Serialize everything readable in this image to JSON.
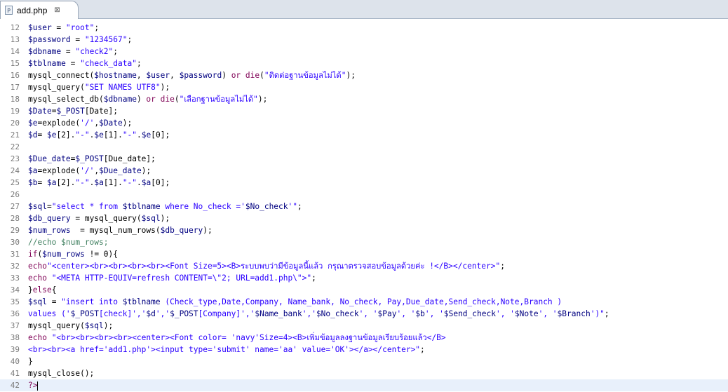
{
  "tab": {
    "label": "add.php",
    "close_symbol": "⊠"
  },
  "lines": [
    {
      "n": 12,
      "segs": [
        [
          "sv",
          "$user"
        ],
        [
          "op",
          " = "
        ],
        [
          "str",
          "\"root\""
        ],
        [
          "op",
          ";"
        ]
      ]
    },
    {
      "n": 13,
      "segs": [
        [
          "sv",
          "$password"
        ],
        [
          "op",
          " = "
        ],
        [
          "str",
          "\"1234567\""
        ],
        [
          "op",
          ";"
        ]
      ]
    },
    {
      "n": 14,
      "segs": [
        [
          "sv",
          "$dbname"
        ],
        [
          "op",
          " = "
        ],
        [
          "str",
          "\"check2\""
        ],
        [
          "op",
          ";"
        ]
      ]
    },
    {
      "n": 15,
      "segs": [
        [
          "sv",
          "$tblname"
        ],
        [
          "op",
          " = "
        ],
        [
          "str",
          "\"check_data\""
        ],
        [
          "op",
          ";"
        ]
      ]
    },
    {
      "n": 16,
      "segs": [
        [
          "op",
          "mysql_connect("
        ],
        [
          "sv",
          "$hostname"
        ],
        [
          "op",
          ", "
        ],
        [
          "sv",
          "$user"
        ],
        [
          "op",
          ", "
        ],
        [
          "sv",
          "$password"
        ],
        [
          "op",
          ") "
        ],
        [
          "kw",
          "or die"
        ],
        [
          "op",
          "("
        ],
        [
          "str",
          "\"ติดต่อฐานข้อมูลไม่ได้\""
        ],
        [
          "op",
          ");"
        ]
      ]
    },
    {
      "n": 17,
      "segs": [
        [
          "op",
          "mysql_query("
        ],
        [
          "str",
          "\"SET NAMES UTF8\""
        ],
        [
          "op",
          ");"
        ]
      ]
    },
    {
      "n": 18,
      "segs": [
        [
          "op",
          "mysql_select_db("
        ],
        [
          "sv",
          "$dbname"
        ],
        [
          "op",
          ") "
        ],
        [
          "kw",
          "or die"
        ],
        [
          "op",
          "("
        ],
        [
          "str",
          "\"เลือกฐานข้อมูลไม่ได้\""
        ],
        [
          "op",
          ");"
        ]
      ]
    },
    {
      "n": 19,
      "segs": [
        [
          "sv",
          "$Date"
        ],
        [
          "op",
          "="
        ],
        [
          "sv",
          "$_POST"
        ],
        [
          "op",
          "[Date];"
        ]
      ]
    },
    {
      "n": 20,
      "segs": [
        [
          "sv",
          "$e"
        ],
        [
          "op",
          "=explode("
        ],
        [
          "str",
          "'/'"
        ],
        [
          "op",
          ","
        ],
        [
          "sv",
          "$Date"
        ],
        [
          "op",
          ");"
        ]
      ]
    },
    {
      "n": 21,
      "segs": [
        [
          "sv",
          "$d"
        ],
        [
          "op",
          "= "
        ],
        [
          "sv",
          "$e"
        ],
        [
          "op",
          "[2]."
        ],
        [
          "str",
          "\"-\""
        ],
        [
          "op",
          "."
        ],
        [
          "sv",
          "$e"
        ],
        [
          "op",
          "[1]."
        ],
        [
          "str",
          "\"-\""
        ],
        [
          "op",
          "."
        ],
        [
          "sv",
          "$e"
        ],
        [
          "op",
          "[0];"
        ]
      ]
    },
    {
      "n": 22,
      "segs": []
    },
    {
      "n": 23,
      "segs": [
        [
          "sv",
          "$Due_date"
        ],
        [
          "op",
          "="
        ],
        [
          "sv",
          "$_POST"
        ],
        [
          "op",
          "[Due_date];"
        ]
      ]
    },
    {
      "n": 24,
      "segs": [
        [
          "sv",
          "$a"
        ],
        [
          "op",
          "=explode("
        ],
        [
          "str",
          "'/'"
        ],
        [
          "op",
          ","
        ],
        [
          "sv",
          "$Due_date"
        ],
        [
          "op",
          ");"
        ]
      ]
    },
    {
      "n": 25,
      "segs": [
        [
          "sv",
          "$b"
        ],
        [
          "op",
          "= "
        ],
        [
          "sv",
          "$a"
        ],
        [
          "op",
          "[2]."
        ],
        [
          "str",
          "\"-\""
        ],
        [
          "op",
          "."
        ],
        [
          "sv",
          "$a"
        ],
        [
          "op",
          "[1]."
        ],
        [
          "str",
          "\"-\""
        ],
        [
          "op",
          "."
        ],
        [
          "sv",
          "$a"
        ],
        [
          "op",
          "[0];"
        ]
      ]
    },
    {
      "n": 26,
      "segs": []
    },
    {
      "n": 27,
      "segs": [
        [
          "sv",
          "$sql"
        ],
        [
          "op",
          "="
        ],
        [
          "str",
          "\"select * from "
        ],
        [
          "sv",
          "$tblname"
        ],
        [
          "str",
          " where No_check ='"
        ],
        [
          "sv",
          "$No_check"
        ],
        [
          "str",
          "'\""
        ],
        [
          "op",
          ";"
        ]
      ]
    },
    {
      "n": 28,
      "segs": [
        [
          "sv",
          "$db_query"
        ],
        [
          "op",
          " = mysql_query("
        ],
        [
          "sv",
          "$sql"
        ],
        [
          "op",
          ");"
        ]
      ]
    },
    {
      "n": 29,
      "segs": [
        [
          "sv",
          "$num_rows"
        ],
        [
          "op",
          "  = mysql_num_rows("
        ],
        [
          "sv",
          "$db_query"
        ],
        [
          "op",
          ");"
        ]
      ]
    },
    {
      "n": 30,
      "segs": [
        [
          "cm",
          "//echo $num_rows;"
        ]
      ]
    },
    {
      "n": 31,
      "segs": [
        [
          "kw",
          "if"
        ],
        [
          "op",
          "("
        ],
        [
          "sv",
          "$num_rows"
        ],
        [
          "op",
          " != 0){"
        ]
      ]
    },
    {
      "n": 32,
      "segs": [
        [
          "kw",
          "echo"
        ],
        [
          "str",
          "\"<center><br><br><br><br><Font Size=5><B>ระบบพบว่ามีข้อมูลนี้แล้ว กรุณาตรวจสอบข้อมูลด้วยค่ะ !</B></center>\""
        ],
        [
          "op",
          ";"
        ]
      ]
    },
    {
      "n": 33,
      "segs": [
        [
          "kw",
          "echo "
        ],
        [
          "str",
          "\"<META HTTP-EQUIV=refresh CONTENT=\\\"2; URL=add1.php\\\">\""
        ],
        [
          "op",
          ";"
        ]
      ]
    },
    {
      "n": 34,
      "segs": [
        [
          "op",
          "}"
        ],
        [
          "kw",
          "else"
        ],
        [
          "op",
          "{"
        ]
      ]
    },
    {
      "n": 35,
      "segs": [
        [
          "sv",
          "$sql"
        ],
        [
          "op",
          " = "
        ],
        [
          "str",
          "\"insert into "
        ],
        [
          "sv",
          "$tblname"
        ],
        [
          "str",
          " (Check_type,Date,Company, Name_bank, No_check, Pay,Due_date,Send_check,Note,Branch )"
        ]
      ]
    },
    {
      "n": 36,
      "segs": [
        [
          "str",
          "values ('"
        ],
        [
          "sv",
          "$_POST"
        ],
        [
          "str",
          "[check]','"
        ],
        [
          "sv",
          "$d"
        ],
        [
          "str",
          "','"
        ],
        [
          "sv",
          "$_POST"
        ],
        [
          "str",
          "[Company]','"
        ],
        [
          "sv",
          "$Name_bank"
        ],
        [
          "str",
          "','"
        ],
        [
          "sv",
          "$No_check"
        ],
        [
          "str",
          "', '"
        ],
        [
          "sv",
          "$Pay"
        ],
        [
          "str",
          "', '"
        ],
        [
          "sv",
          "$b"
        ],
        [
          "str",
          "', '"
        ],
        [
          "sv",
          "$Send_check"
        ],
        [
          "str",
          "', '"
        ],
        [
          "sv",
          "$Note"
        ],
        [
          "str",
          "', '"
        ],
        [
          "sv",
          "$Branch"
        ],
        [
          "str",
          "')\""
        ],
        [
          "op",
          ";"
        ]
      ]
    },
    {
      "n": 37,
      "segs": [
        [
          "op",
          "mysql_query("
        ],
        [
          "sv",
          "$sql"
        ],
        [
          "op",
          ");"
        ]
      ]
    },
    {
      "n": 38,
      "segs": [
        [
          "kw",
          "echo "
        ],
        [
          "str",
          "\"<br><br><br><br><center><Font color= 'navy'Size=4><B>เพิ่มข้อมูลลงฐานข้อมูลเรียบร้อยแล้ว</B>"
        ]
      ]
    },
    {
      "n": 39,
      "segs": [
        [
          "str",
          "<br><br><a href='add1.php'><input type='submit' name='aa' value='OK'></a></center>\""
        ],
        [
          "op",
          ";"
        ]
      ]
    },
    {
      "n": 40,
      "segs": [
        [
          "op",
          "}"
        ]
      ]
    },
    {
      "n": 41,
      "segs": [
        [
          "op",
          "mysql_close();"
        ]
      ]
    },
    {
      "n": 42,
      "segs": [
        [
          "php",
          "?>"
        ]
      ],
      "current": true
    }
  ],
  "colors": {
    "variable": "#000080",
    "keyword": "#7f0055",
    "string": "#2a00ff",
    "comment": "#3f7f5f",
    "current_line": "#e8f0fb"
  }
}
